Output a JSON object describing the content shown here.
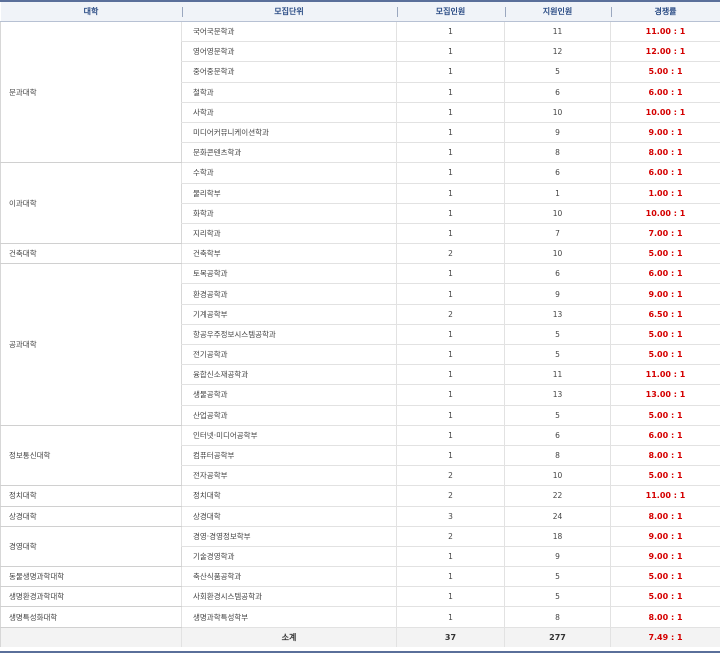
{
  "header": {
    "college": "대학",
    "unit": "모집단위",
    "quota": "모집인원",
    "applicants": "지원인원",
    "ratio": "경쟁률"
  },
  "groups": [
    {
      "name": "문과대학",
      "rows": [
        {
          "unit": "국어국문학과",
          "quota": "1",
          "applicants": "11",
          "ratio": "11.00 : 1"
        },
        {
          "unit": "영어영문학과",
          "quota": "1",
          "applicants": "12",
          "ratio": "12.00 : 1"
        },
        {
          "unit": "중어중문학과",
          "quota": "1",
          "applicants": "5",
          "ratio": "5.00 : 1"
        },
        {
          "unit": "철학과",
          "quota": "1",
          "applicants": "6",
          "ratio": "6.00 : 1"
        },
        {
          "unit": "사학과",
          "quota": "1",
          "applicants": "10",
          "ratio": "10.00 : 1"
        },
        {
          "unit": "미디어커뮤니케이션학과",
          "quota": "1",
          "applicants": "9",
          "ratio": "9.00 : 1"
        },
        {
          "unit": "문화콘텐츠학과",
          "quota": "1",
          "applicants": "8",
          "ratio": "8.00 : 1"
        }
      ]
    },
    {
      "name": "이과대학",
      "rows": [
        {
          "unit": "수학과",
          "quota": "1",
          "applicants": "6",
          "ratio": "6.00 : 1"
        },
        {
          "unit": "물리학부",
          "quota": "1",
          "applicants": "1",
          "ratio": "1.00 : 1"
        },
        {
          "unit": "화학과",
          "quota": "1",
          "applicants": "10",
          "ratio": "10.00 : 1"
        },
        {
          "unit": "지리학과",
          "quota": "1",
          "applicants": "7",
          "ratio": "7.00 : 1"
        }
      ]
    },
    {
      "name": "건축대학",
      "rows": [
        {
          "unit": "건축학부",
          "quota": "2",
          "applicants": "10",
          "ratio": "5.00 : 1"
        }
      ]
    },
    {
      "name": "공과대학",
      "rows": [
        {
          "unit": "토목공학과",
          "quota": "1",
          "applicants": "6",
          "ratio": "6.00 : 1"
        },
        {
          "unit": "환경공학과",
          "quota": "1",
          "applicants": "9",
          "ratio": "9.00 : 1"
        },
        {
          "unit": "기계공학부",
          "quota": "2",
          "applicants": "13",
          "ratio": "6.50 : 1"
        },
        {
          "unit": "항공우주정보시스템공학과",
          "quota": "1",
          "applicants": "5",
          "ratio": "5.00 : 1"
        },
        {
          "unit": "전기공학과",
          "quota": "1",
          "applicants": "5",
          "ratio": "5.00 : 1"
        },
        {
          "unit": "융합신소재공학과",
          "quota": "1",
          "applicants": "11",
          "ratio": "11.00 : 1"
        },
        {
          "unit": "생물공학과",
          "quota": "1",
          "applicants": "13",
          "ratio": "13.00 : 1"
        },
        {
          "unit": "산업공학과",
          "quota": "1",
          "applicants": "5",
          "ratio": "5.00 : 1"
        }
      ]
    },
    {
      "name": "정보통신대학",
      "rows": [
        {
          "unit": "인터넷·미디어공학부",
          "quota": "1",
          "applicants": "6",
          "ratio": "6.00 : 1"
        },
        {
          "unit": "컴퓨터공학부",
          "quota": "1",
          "applicants": "8",
          "ratio": "8.00 : 1"
        },
        {
          "unit": "전자공학부",
          "quota": "2",
          "applicants": "10",
          "ratio": "5.00 : 1"
        }
      ]
    },
    {
      "name": "정치대학",
      "rows": [
        {
          "unit": "정치대학",
          "quota": "2",
          "applicants": "22",
          "ratio": "11.00 : 1"
        }
      ]
    },
    {
      "name": "상경대학",
      "rows": [
        {
          "unit": "상경대학",
          "quota": "3",
          "applicants": "24",
          "ratio": "8.00 : 1"
        }
      ]
    },
    {
      "name": "경영대학",
      "rows": [
        {
          "unit": "경영·경영정보학부",
          "quota": "2",
          "applicants": "18",
          "ratio": "9.00 : 1"
        },
        {
          "unit": "기술경영학과",
          "quota": "1",
          "applicants": "9",
          "ratio": "9.00 : 1"
        }
      ]
    },
    {
      "name": "동물생명과학대학",
      "rows": [
        {
          "unit": "축산식품공학과",
          "quota": "1",
          "applicants": "5",
          "ratio": "5.00 : 1"
        }
      ]
    },
    {
      "name": "생명환경과학대학",
      "rows": [
        {
          "unit": "사회환경시스템공학과",
          "quota": "1",
          "applicants": "5",
          "ratio": "5.00 : 1"
        }
      ]
    },
    {
      "name": "생명특성화대학",
      "rows": [
        {
          "unit": "생명과학특성학부",
          "quota": "1",
          "applicants": "8",
          "ratio": "8.00 : 1"
        }
      ]
    }
  ],
  "total": {
    "label": "소계",
    "quota": "37",
    "applicants": "277",
    "ratio": "7.49 : 1"
  },
  "colors": {
    "header_text": "#2c4d86",
    "ratio_text": "#d40000",
    "border": "#5a6f9a"
  }
}
